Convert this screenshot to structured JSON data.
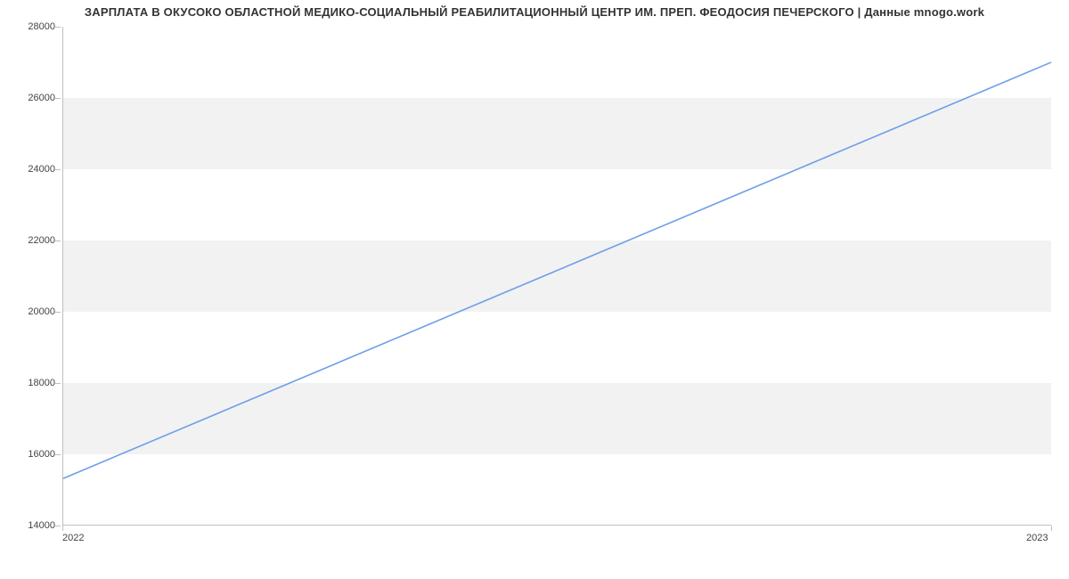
{
  "chart_data": {
    "type": "line",
    "title": "ЗАРПЛАТА В ОКУСОКО ОБЛАСТНОЙ МЕДИКО-СОЦИАЛЬНЫЙ РЕАБИЛИТАЦИОННЫЙ ЦЕНТР ИМ. ПРЕП. ФЕОДОСИЯ ПЕЧЕРСКОГО | Данные mnogo.work",
    "x": [
      2022,
      2023
    ],
    "values": [
      15300,
      27000
    ],
    "xlabel": "",
    "ylabel": "",
    "xlim": [
      2022,
      2023
    ],
    "ylim": [
      14000,
      28000
    ],
    "yticks": [
      14000,
      16000,
      18000,
      20000,
      22000,
      24000,
      26000,
      28000
    ],
    "xticks": [
      2022,
      2023
    ],
    "bands_alternate": true,
    "line_color": "#6f9ee8"
  }
}
